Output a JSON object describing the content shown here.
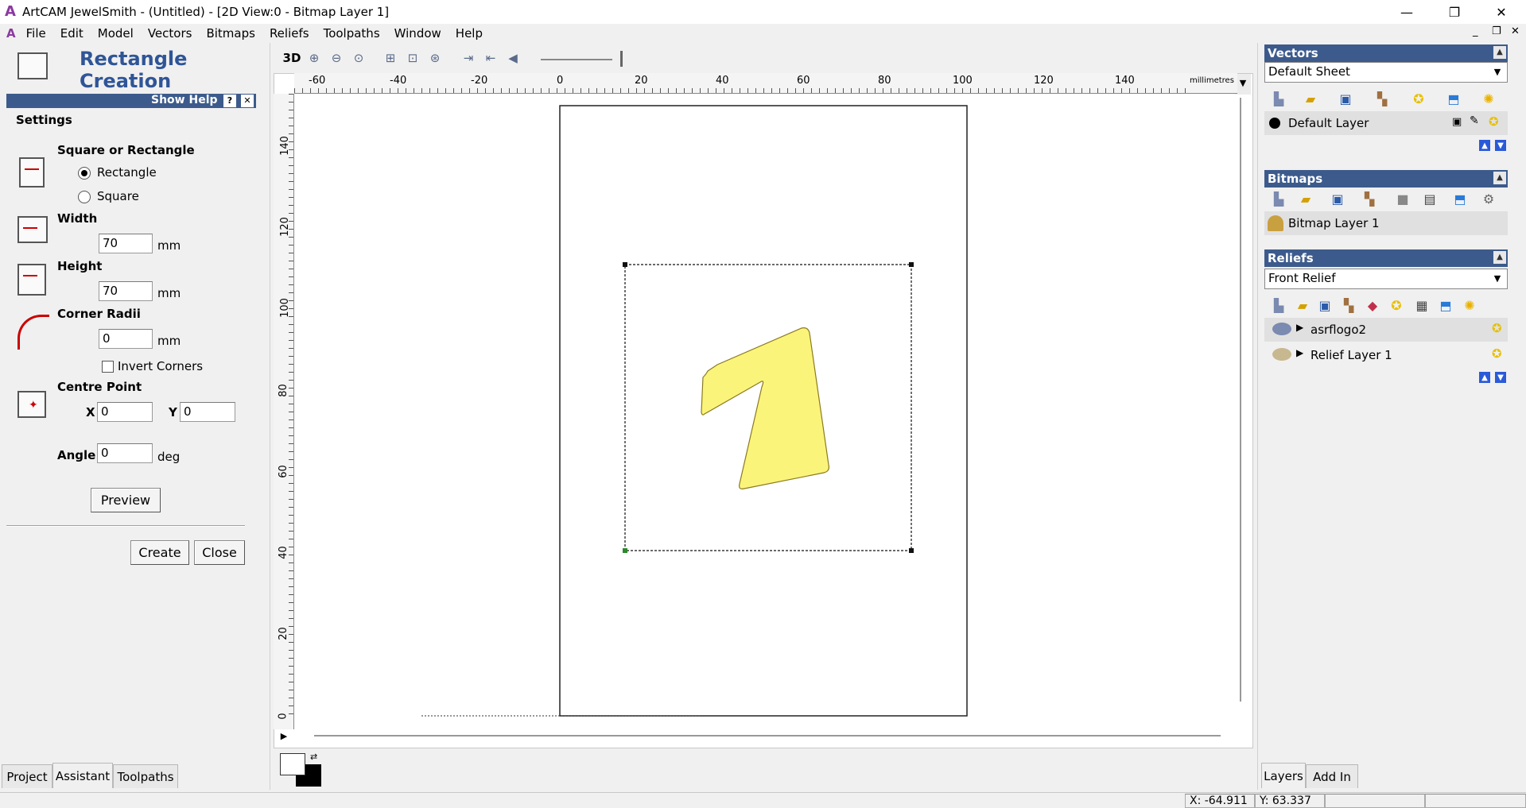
{
  "window": {
    "title": "ArtCAM JewelSmith - (Untitled) - [2D View:0 - Bitmap Layer 1]",
    "minimize": "—",
    "restore": "❐",
    "close": "✕",
    "inner_minimize": "_",
    "inner_restore": "❐",
    "inner_close": "✕"
  },
  "menubar": [
    "File",
    "Edit",
    "Model",
    "Vectors",
    "Bitmaps",
    "Reliefs",
    "Toolpaths",
    "Window",
    "Help"
  ],
  "left": {
    "title": "Rectangle Creation",
    "show_help": "Show Help",
    "help_q": "?",
    "help_x": "✕",
    "settings": "Settings",
    "square_or_rect": "Square or Rectangle",
    "opt_rectangle": "Rectangle",
    "opt_square": "Square",
    "width_label": "Width",
    "width_value": "70",
    "height_label": "Height",
    "height_value": "70",
    "unit_mm": "mm",
    "corner_label": "Corner Radii",
    "corner_value": "0",
    "invert_corners": "Invert Corners",
    "centre_label": "Centre Point",
    "x_label": "X",
    "x_value": "0",
    "y_label": "Y",
    "y_value": "0",
    "angle_label": "Angle",
    "angle_value": "0",
    "angle_unit": "deg",
    "preview": "Preview",
    "create": "Create",
    "close": "Close",
    "tabs": [
      "Project",
      "Assistant",
      "Toolpaths"
    ],
    "active_tab": "Assistant"
  },
  "view": {
    "mode_3d": "3D",
    "ruler_unit": "millimetres",
    "h_ticks": [
      "-60",
      "-40",
      "-20",
      "0",
      "20",
      "40",
      "60",
      "80",
      "100",
      "120",
      "140"
    ],
    "v_ticks": [
      "140",
      "120",
      "100",
      "80",
      "60",
      "40",
      "20",
      "0"
    ]
  },
  "right": {
    "vectors_title": "Vectors",
    "vectors_sheet": "Default Sheet",
    "default_layer": "Default Layer",
    "bitmaps_title": "Bitmaps",
    "bitmap_layer": "Bitmap Layer 1",
    "reliefs_title": "Reliefs",
    "relief_select": "Front Relief",
    "relief_items": [
      "asrflogo2",
      "Relief Layer 1"
    ],
    "tabs": [
      "Layers",
      "Add In"
    ],
    "active_tab": "Layers"
  },
  "status": {
    "x": "X: -64.911",
    "y": "Y: 63.337"
  },
  "colors": {
    "accent": "#3c5b8c",
    "title_blue": "#2f5597",
    "shape_fill": "#fbf47a"
  }
}
